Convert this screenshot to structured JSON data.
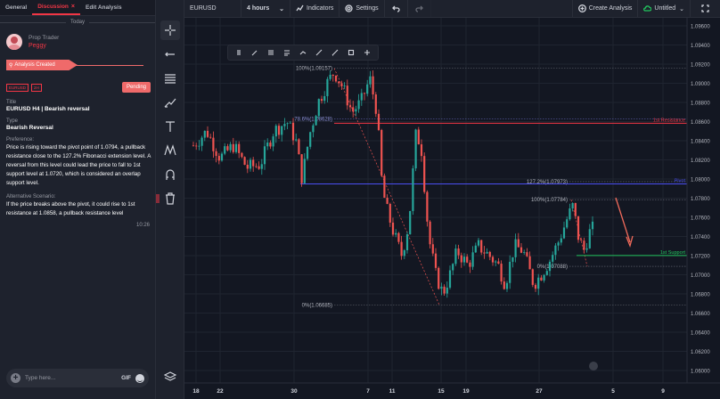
{
  "left_panel": {
    "tabs": [
      {
        "label": "General"
      },
      {
        "label": "Discussion",
        "close": "×"
      },
      {
        "label": "Edit Analysis"
      }
    ],
    "day_separator": "Today",
    "message": {
      "author_role": "Prop Trader",
      "author_name": "Peggy",
      "banner": "Analysis Created",
      "symbol_badge": "EURUSD",
      "timeframe_badge": "2H",
      "status_button": "Pending",
      "title_label": "Title",
      "title_value": "EURUSD H4 | Bearish reversal",
      "type_label": "Type",
      "type_value": "Bearish Reversal",
      "preference_label": "Preference:",
      "preference_text": "Price is rising toward the pivot point of 1.0794, a pullback resistance close to the 127.2% Fibonacci extension level. A reversal from this level could lead the price to fall to 1st support level at 1.0720, which is considered an overlap support level.",
      "alt_label": "Alternative Scenario:",
      "alt_text": "If the price breaks above the pivot, it could rise to 1st resistance at 1.0858, a pullback resistance level",
      "time": "10:26"
    },
    "composer": {
      "placeholder": "Type here...",
      "gif_label": "GIF"
    }
  },
  "topbar": {
    "symbol": "EURUSD",
    "interval": "4 hours",
    "indicators_label": "Indicators",
    "settings_label": "Settings",
    "create_analysis_label": "Create Analysis",
    "layout_label": "Untitled"
  },
  "chart": {
    "price_labels": [
      "1.09600",
      "1.09400",
      "1.09200",
      "1.09000",
      "1.08800",
      "1.08600",
      "1.08400",
      "1.08200",
      "1.08000",
      "1.07800",
      "1.07600",
      "1.07400",
      "1.07200",
      "1.07000",
      "1.06800",
      "1.06600",
      "1.06400",
      "1.06200",
      "1.06000"
    ],
    "date_labels": [
      "18",
      "22",
      "30",
      "7",
      "11",
      "15",
      "19",
      "27",
      "5",
      "9"
    ],
    "fib_labels": {
      "top": "100%(1.09157)",
      "fib786": "78.6%(1.08628)",
      "bottom": "0%(1.06685)",
      "ext1272": "127.2%(1.07973)",
      "ext100": "100%(1.07784)",
      "ext0": "0%(1.07088)"
    },
    "levels": {
      "resistance_label": "1st Resistance",
      "resistance_value": "1.08582",
      "pivot_label": "Pivot",
      "pivot_value": "1.07949",
      "support_label": "1st Support",
      "support_value": "1.07201",
      "current_price": "1.07451"
    },
    "colors": {
      "bull": "#26a69a",
      "bear": "#ef5350",
      "resistance": "#f23645",
      "pivot": "#4a4ef2",
      "support": "#22c55e",
      "arrow": "#f26b5b"
    }
  }
}
